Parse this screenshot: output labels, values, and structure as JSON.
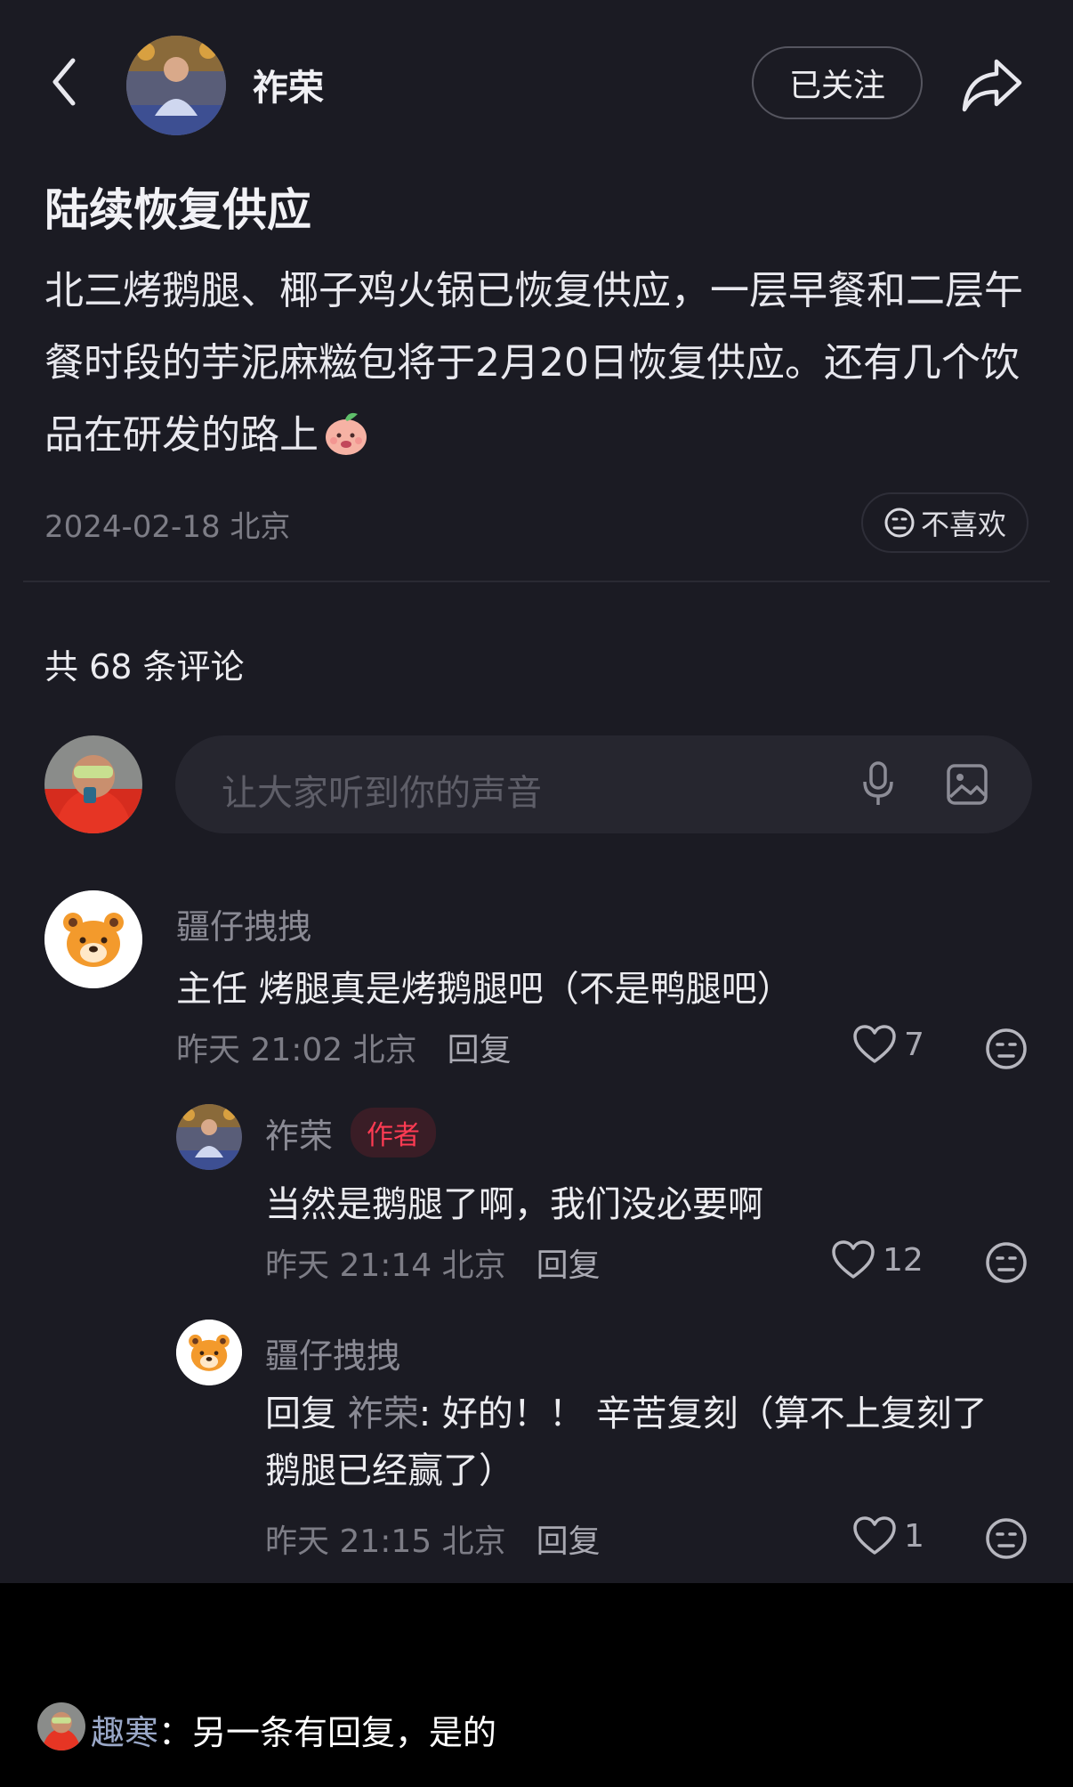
{
  "header": {
    "author_name": "祚荣",
    "follow_label": "已关注"
  },
  "post": {
    "title": "陆续恢复供应",
    "body": "北三烤鹅腿、椰子鸡火锅已恢复供应，一层早餐和二层午餐时段的芋泥麻糍包将于2月20日恢复供应。还有几个饮品在研发的路上",
    "meta": "2024-02-18 北京",
    "dislike_label": "不喜欢"
  },
  "comments_section": {
    "count_label": "共 68 条评论",
    "input_placeholder": "让大家听到你的声音"
  },
  "comments": [
    {
      "author": "疆仔拽拽",
      "text": "主任 烤腿真是烤鹅腿吧（不是鸭腿吧）",
      "meta": "昨天 21:02 北京",
      "reply_label": "回复",
      "likes": "7"
    },
    {
      "author": "祚荣",
      "badge": "作者",
      "text": "当然是鹅腿了啊，我们没必要啊",
      "meta": "昨天 21:14 北京",
      "reply_label": "回复",
      "likes": "12"
    },
    {
      "author": "疆仔拽拽",
      "reply_prefix": "回复",
      "reply_to": "祚荣",
      "text": ": 好的！！ 辛苦复刻（算不上复刻了 鹅腿已经赢了）",
      "meta": "昨天 21:15 北京",
      "reply_label": "回复",
      "likes": "1"
    }
  ],
  "overlay_caption": {
    "name": "趣寒",
    "text": "：另一条有回复，是的"
  },
  "colors": {
    "background": "#1b1b23",
    "badge_red": "#ff3b53",
    "overlay_background": "#000000"
  }
}
